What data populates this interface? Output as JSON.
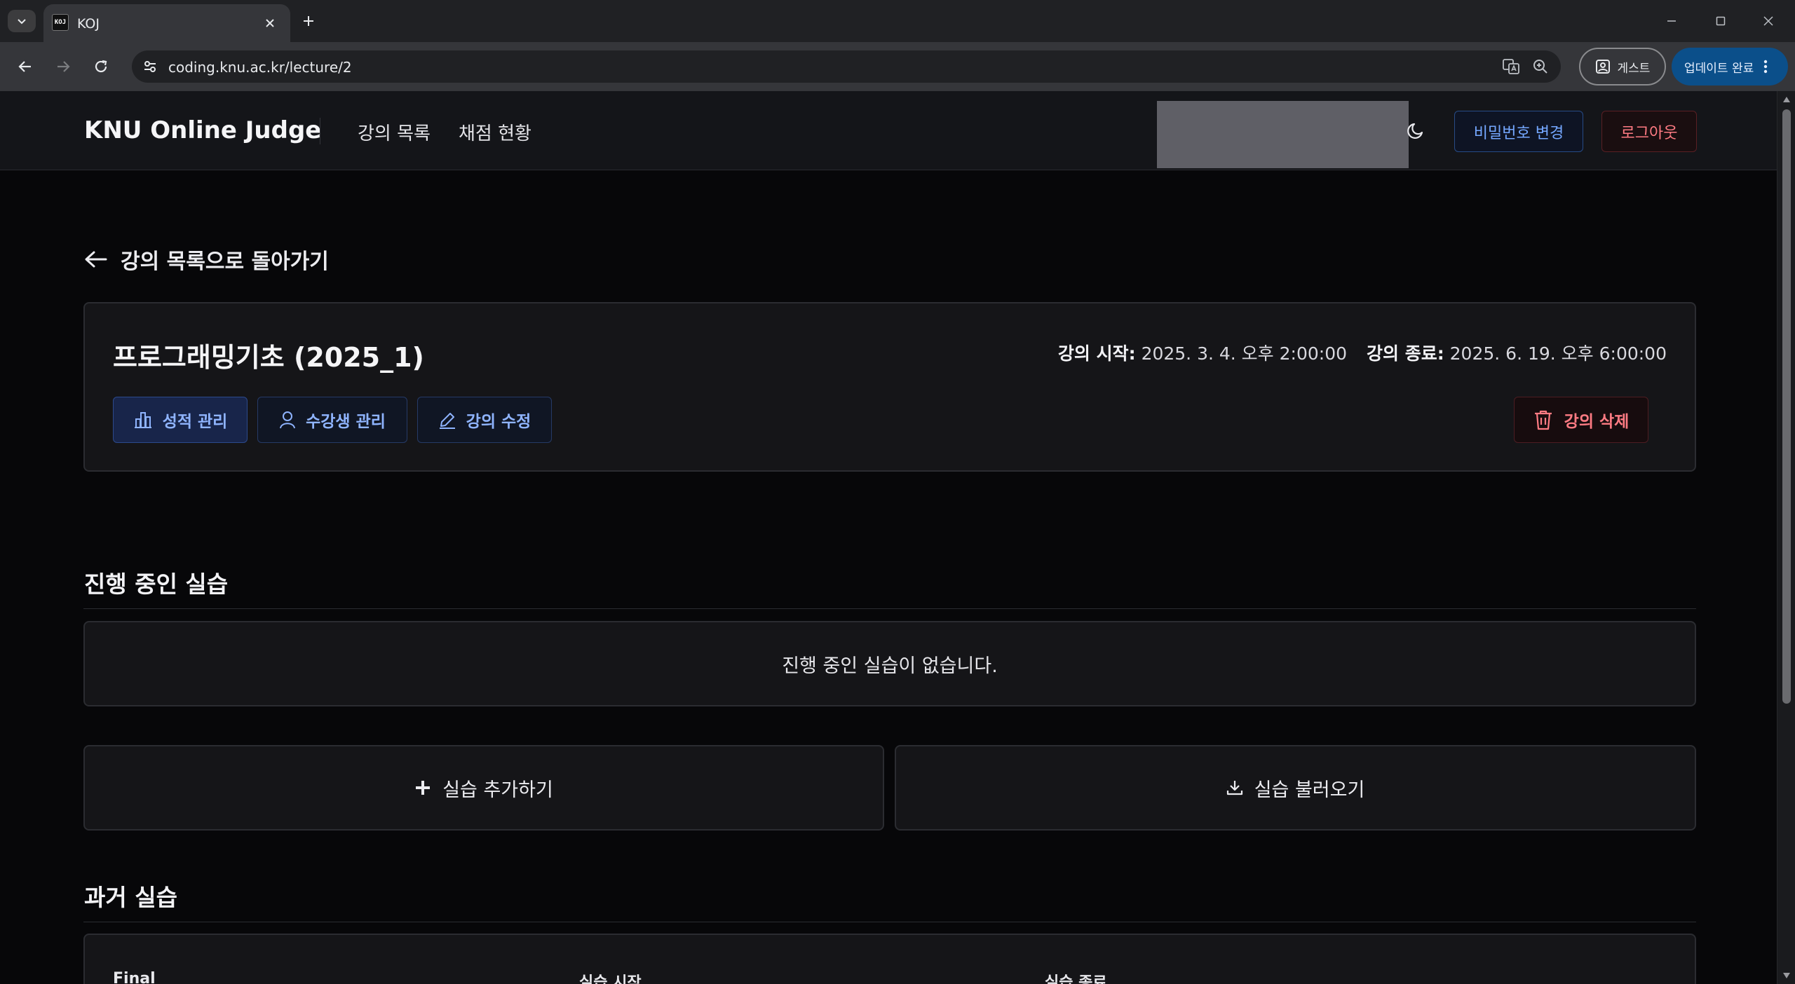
{
  "browser": {
    "tab_title": "KOJ",
    "favicon_text": "KOJ",
    "url": "coding.knu.ac.kr/lecture/2",
    "guest_label": "게스트",
    "update_label": "업데이트 완료"
  },
  "header": {
    "brand": "KNU Online Judge",
    "nav": [
      "강의 목록",
      "채점 현황"
    ],
    "change_password": "비밀번호 변경",
    "logout": "로그아웃"
  },
  "back_link": "강의 목록으로 돌아가기",
  "lecture": {
    "title": "프로그래밍기초 (2025_1)",
    "start_label": "강의 시작:",
    "start_value": "2025. 3. 4. 오후 2:00:00",
    "end_label": "강의 종료:",
    "end_value": "2025. 6. 19. 오후 6:00:00",
    "buttons": {
      "grades": "성적 관리",
      "students": "수강생 관리",
      "edit": "강의 수정",
      "delete": "강의 삭제"
    }
  },
  "ongoing": {
    "heading": "진행 중인 실습",
    "empty_message": "진행 중인 실습이 없습니다."
  },
  "actions": {
    "add": "실습 추가하기",
    "import": "실습 불러오기"
  },
  "past": {
    "heading": "과거 실습",
    "first_card": {
      "name": "Final",
      "start_label": "실습 시작",
      "end_label": "실습 종료"
    }
  },
  "colors": {
    "page_bg": "#070709",
    "card_bg": "#151518",
    "accent_blue": "#74a7ff",
    "danger_red": "#ff7b83",
    "chrome_update": "#0b4f8a"
  },
  "icons": {
    "grades": "bar-chart-icon",
    "students": "user-icon",
    "edit": "pencil-icon",
    "delete": "trash-icon",
    "add": "plus-icon",
    "import": "download-icon",
    "theme": "moon-icon",
    "back": "arrow-left-icon"
  }
}
